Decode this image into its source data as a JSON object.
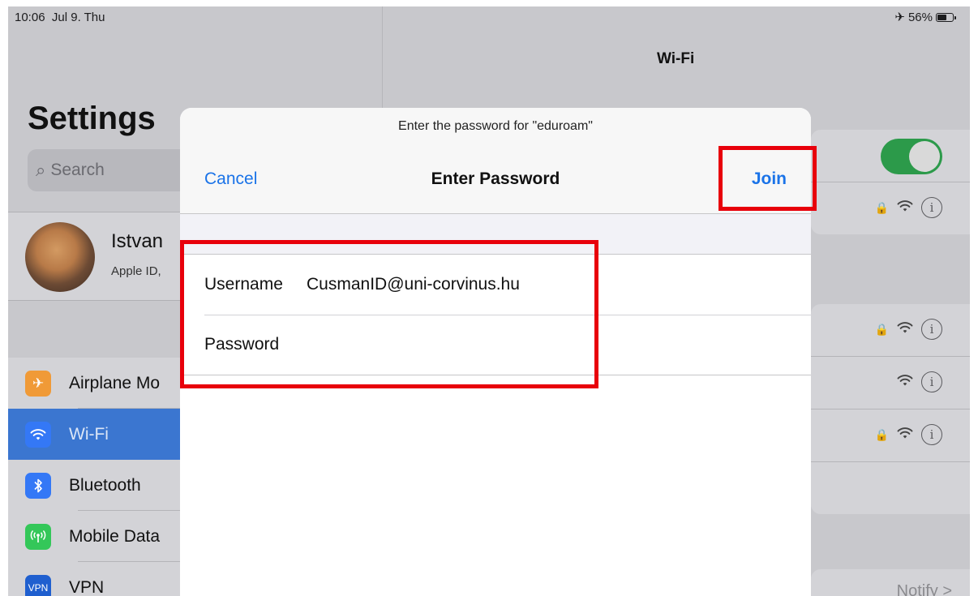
{
  "status_bar": {
    "time": "10:06",
    "date": "Jul 9. Thu",
    "battery": "56%"
  },
  "settings": {
    "title": "Settings",
    "search_placeholder": "Search",
    "profile": {
      "name": "Istvan",
      "subtitle": "Apple ID,"
    },
    "items": [
      {
        "label": "Airplane Mo",
        "icon": "airplane-icon",
        "color": "#f09a37",
        "selected": false
      },
      {
        "label": "Wi-Fi",
        "icon": "wifi-icon",
        "color": "#3478f6",
        "selected": true
      },
      {
        "label": "Bluetooth",
        "icon": "bluetooth-icon",
        "color": "#3478f6",
        "selected": false
      },
      {
        "label": "Mobile Data",
        "icon": "antenna-icon",
        "color": "#34c759",
        "selected": false
      },
      {
        "label": "VPN",
        "icon": "vpn-icon",
        "color": "#1f5fcf",
        "selected": false
      }
    ]
  },
  "wifi_panel": {
    "title": "Wi-Fi",
    "notify": "Notify >"
  },
  "dialog": {
    "prompt": "Enter the password for \"eduroam\"",
    "cancel_label": "Cancel",
    "title": "Enter Password",
    "join_label": "Join",
    "username_label": "Username",
    "username_value": "CusmanID@uni-corvinus.hu",
    "password_label": "Password",
    "password_value": ""
  },
  "colors": {
    "accent": "#1a73e8",
    "highlight": "#e8000b",
    "toggle_on": "#2c9a4a",
    "selected_row": "#3b76d0"
  }
}
